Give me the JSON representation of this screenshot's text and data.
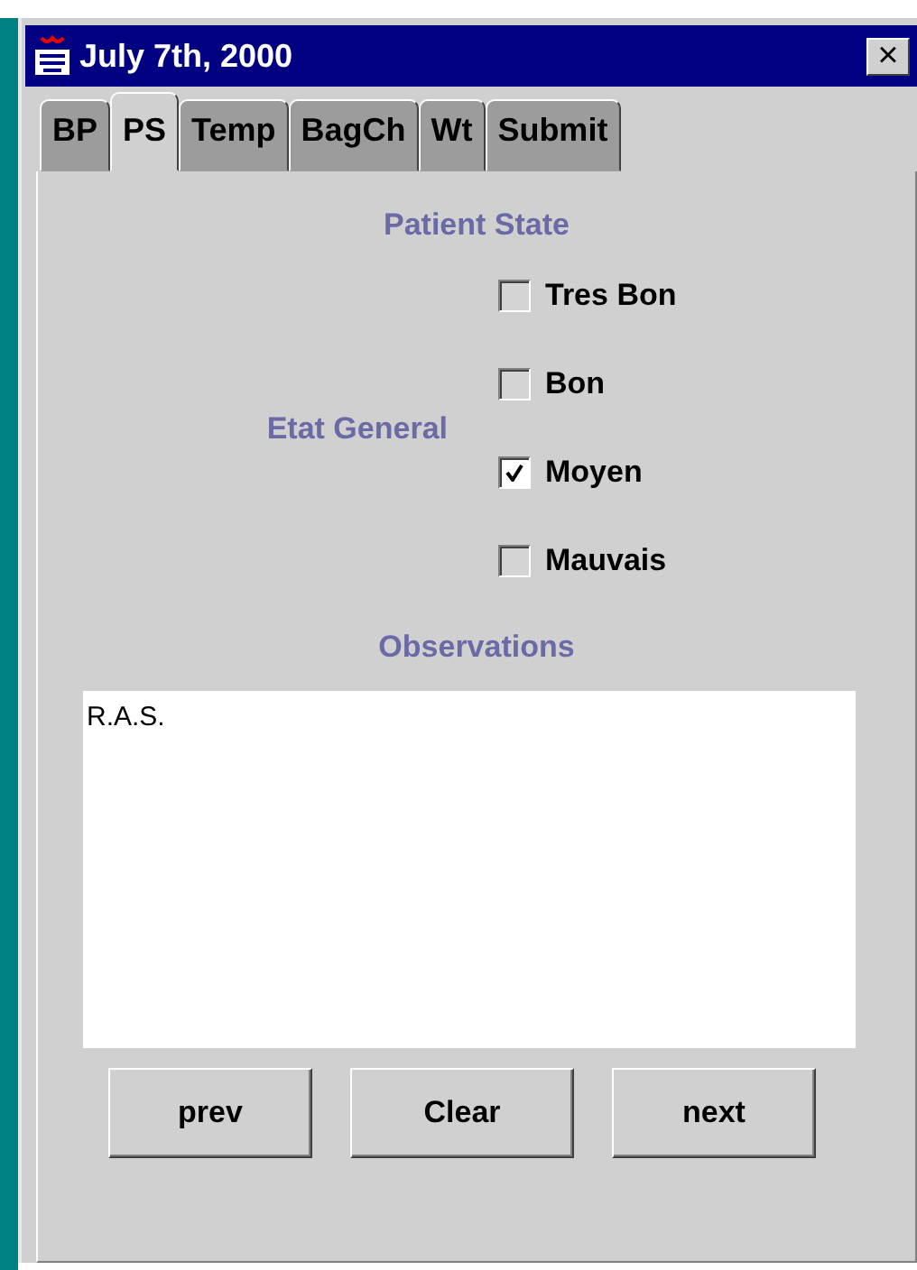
{
  "window": {
    "title": "July 7th, 2000",
    "close": "×"
  },
  "tabs": [
    {
      "label": "BP",
      "selected": false
    },
    {
      "label": "PS",
      "selected": true
    },
    {
      "label": "Temp",
      "selected": false
    },
    {
      "label": "BagCh",
      "selected": false
    },
    {
      "label": "Wt",
      "selected": false
    },
    {
      "label": "Submit",
      "selected": false
    }
  ],
  "section_title": "Patient State",
  "etat_general": {
    "label": "Etat General",
    "options": [
      {
        "label": "Tres Bon",
        "checked": false
      },
      {
        "label": "Bon",
        "checked": false
      },
      {
        "label": "Moyen",
        "checked": true
      },
      {
        "label": "Mauvais",
        "checked": false
      }
    ]
  },
  "observations": {
    "label": "Observations",
    "value": "R.A.S."
  },
  "buttons": [
    "prev",
    "Clear",
    "next"
  ]
}
